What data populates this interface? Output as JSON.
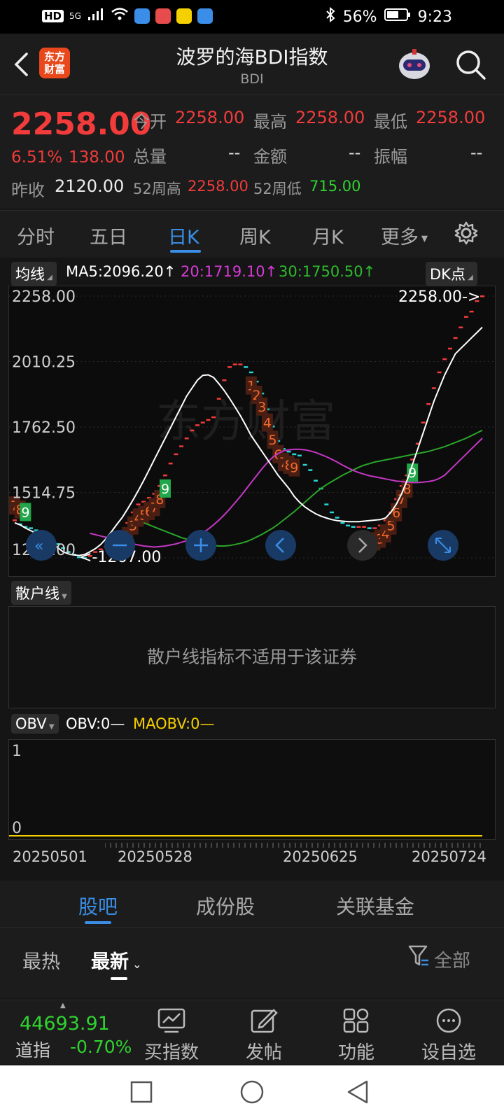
{
  "status_bar": {
    "time": "9:23",
    "battery": "56%",
    "network": "5G",
    "hd": "HD"
  },
  "header": {
    "title": "波罗的海BDI指数",
    "subtitle": "BDI",
    "logo_text": "东方财富"
  },
  "quote": {
    "price": "2258.00",
    "change_pct": "6.51%",
    "change": "138.00",
    "prev_close_label": "昨收",
    "prev_close": "2120.00",
    "open_label": "今开",
    "open": "2258.00",
    "high_label": "最高",
    "high": "2258.00",
    "low_label": "最低",
    "low": "2258.00",
    "volume_label": "总量",
    "volume": "--",
    "amount_label": "金额",
    "amount": "--",
    "amplitude_label": "振幅",
    "amplitude": "--",
    "w52_high_label": "52周高",
    "w52_high": "2258.00",
    "w52_low_label": "52周低",
    "w52_low": "715.00"
  },
  "period_tabs": [
    "分时",
    "五日",
    "日K",
    "周K",
    "月K",
    "更多"
  ],
  "active_tab": "日K",
  "ma_bar": {
    "selector": "均线",
    "ma5": "MA5:2096.20↑",
    "ma20": "20:1719.10↑",
    "ma30": "30:1750.50↑",
    "dk_button": "DK点"
  },
  "chart_data": {
    "type": "candlestick",
    "y_ticks": [
      "2258.00",
      "2010.25",
      "1762.50",
      "1514.75",
      "1267.00"
    ],
    "ylim": [
      1267,
      2258
    ],
    "high_marker": "2258.00->",
    "low_marker": "<-1267.00",
    "x_labels": [
      "20250501",
      "20250528",
      "20250625",
      "20250724"
    ],
    "watermark": "东方财富",
    "closes": [
      1410,
      1395,
      1385,
      1380,
      1372,
      1360,
      1350,
      1335,
      1320,
      1305,
      1290,
      1280,
      1270,
      1267,
      1275,
      1290,
      1300,
      1310,
      1325,
      1340,
      1360,
      1400,
      1440,
      1470,
      1480,
      1495,
      1510,
      1540,
      1580,
      1625,
      1660,
      1690,
      1720,
      1750,
      1770,
      1780,
      1790,
      1800,
      1870,
      1940,
      1990,
      2000,
      2000,
      1990,
      1970,
      1935,
      1890,
      1830,
      1765,
      1710,
      1680,
      1670,
      1660,
      1655,
      1620,
      1600,
      1560,
      1530,
      1470,
      1440,
      1420,
      1400,
      1390,
      1385,
      1385,
      1385,
      1380,
      1380,
      1390,
      1410,
      1440,
      1490,
      1540,
      1580,
      1640,
      1700,
      1780,
      1850,
      1910,
      1970,
      2020,
      2060,
      2100,
      2140,
      2180,
      2200,
      2240,
      2258
    ],
    "ma5": [
      1400,
      1392,
      1380,
      1370,
      1360,
      1350,
      1338,
      1322,
      1306,
      1290,
      1282,
      1278,
      1276,
      1280,
      1290,
      1302,
      1318,
      1340,
      1366,
      1394,
      1420,
      1452,
      1486,
      1522,
      1560,
      1600,
      1640,
      1680,
      1720,
      1760,
      1800,
      1840,
      1880,
      1910,
      1940,
      1958,
      1960,
      1950,
      1926,
      1900,
      1870,
      1838,
      1805,
      1768,
      1730,
      1700,
      1670,
      1640,
      1610,
      1580,
      1555,
      1530,
      1500,
      1478,
      1460,
      1446,
      1434,
      1425,
      1418,
      1412,
      1408,
      1406,
      1404,
      1404,
      1404,
      1406,
      1408,
      1410,
      1412,
      1418,
      1440,
      1470,
      1510,
      1560,
      1620,
      1680,
      1740,
      1800,
      1860,
      1910,
      1960,
      2000,
      2040,
      2060,
      2080,
      2100,
      2120,
      2140
    ],
    "ma20": [
      1360,
      1355,
      1350,
      1345,
      1340,
      1335,
      1330,
      1325,
      1320,
      1316,
      1312,
      1310,
      1308,
      1310,
      1312,
      1316,
      1320,
      1326,
      1332,
      1340,
      1350,
      1362,
      1376,
      1392,
      1410,
      1430,
      1452,
      1476,
      1500,
      1526,
      1552,
      1578,
      1604,
      1628,
      1648,
      1662,
      1672,
      1676,
      1678,
      1678,
      1676,
      1672,
      1666,
      1658,
      1650,
      1640,
      1630,
      1618,
      1608,
      1598,
      1590,
      1584,
      1578,
      1574,
      1570,
      1566,
      1562,
      1558,
      1556,
      1554,
      1552,
      1552,
      1554,
      1556,
      1560,
      1568,
      1580,
      1600,
      1620,
      1640,
      1660,
      1680,
      1700,
      1720
    ],
    "ma30": [
      1400,
      1392,
      1384,
      1376,
      1368,
      1360,
      1352,
      1344,
      1338,
      1332,
      1326,
      1320,
      1316,
      1314,
      1312,
      1312,
      1314,
      1318,
      1322,
      1328,
      1336,
      1346,
      1356,
      1368,
      1380,
      1394,
      1410,
      1426,
      1442,
      1460,
      1478,
      1496,
      1514,
      1530,
      1544,
      1556,
      1568,
      1580,
      1590,
      1600,
      1610,
      1618,
      1624,
      1630,
      1634,
      1638,
      1642,
      1646,
      1650,
      1654,
      1658,
      1662,
      1666,
      1670,
      1676,
      1682,
      1688,
      1696,
      1704,
      1712,
      1720,
      1730,
      1740,
      1750
    ]
  },
  "dk_signals": {
    "early": [
      "7",
      "8",
      "9"
    ],
    "rise1": [
      "1",
      "2",
      "3",
      "4",
      "5",
      "6",
      "7",
      "8",
      "9"
    ],
    "fall": [
      "1",
      "2",
      "3",
      "4",
      "5",
      "6",
      "7",
      "8",
      "9"
    ],
    "rise2": [
      "1",
      "2",
      "3",
      "4",
      "5",
      "6",
      "7",
      "8",
      "9"
    ]
  },
  "scatter": {
    "selector": "散户线",
    "message": "散户线指标不适用于该证券"
  },
  "obv": {
    "selector": "OBV",
    "obv_label": "OBV:0—",
    "maobv_label": "MAOBV:0—",
    "y_top": "1",
    "y_bottom": "0"
  },
  "bottom_tabs": [
    "股吧",
    "成份股",
    "关联基金"
  ],
  "filters": {
    "hot": "最热",
    "latest": "最新",
    "all": "全部"
  },
  "ticker": {
    "value": "44693.91",
    "name": "道指",
    "change": "-0.70%"
  },
  "actions": [
    "买指数",
    "发帖",
    "功能",
    "设自选"
  ]
}
